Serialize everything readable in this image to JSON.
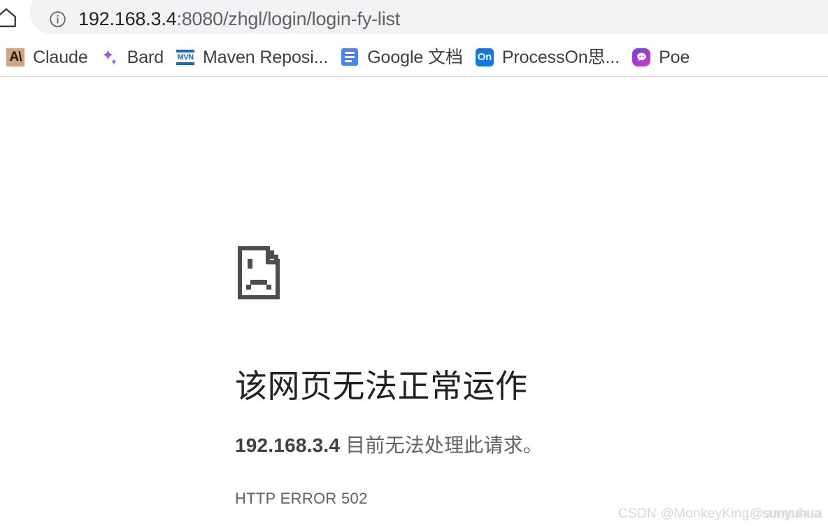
{
  "browser": {
    "home_button": "home-icon",
    "omnibox": {
      "info_icon": "info-circle-icon",
      "url_host": "192.168.3.4",
      "url_rest": ":8080/zhgl/login/login-fy-list",
      "full_url": "192.168.3.4:8080/zhgl/login/login-fy-list"
    },
    "bookmarks": [
      {
        "label": "Claude",
        "icon": "claude-icon",
        "icon_text": "A\\",
        "color": "#d4a27f"
      },
      {
        "label": "Bard",
        "icon": "bard-sparkle-icon",
        "icon_text": "",
        "color": "#8b5cf6"
      },
      {
        "label": "Maven Reposi...",
        "icon": "maven-icon",
        "icon_text": "MVN",
        "color": "#1668c1"
      },
      {
        "label": "Google 文档",
        "icon": "google-docs-icon",
        "icon_text": "",
        "color": "#4285f4"
      },
      {
        "label": "ProcessOn思...",
        "icon": "processon-icon",
        "icon_text": "On",
        "color": "#1077e8"
      },
      {
        "label": "Poe",
        "icon": "poe-icon",
        "icon_text": "",
        "color": "#a03ad6"
      }
    ]
  },
  "error_page": {
    "icon": "sad-document-icon",
    "title": "该网页无法正常运作",
    "subtitle_ip": "192.168.3.4",
    "subtitle_rest": " 目前无法处理此请求。",
    "error_code": "HTTP ERROR 502"
  },
  "watermark": {
    "line_a": "CSDN @MonkeyKing@sunyuhua",
    "line_b": "sunyuhua"
  }
}
